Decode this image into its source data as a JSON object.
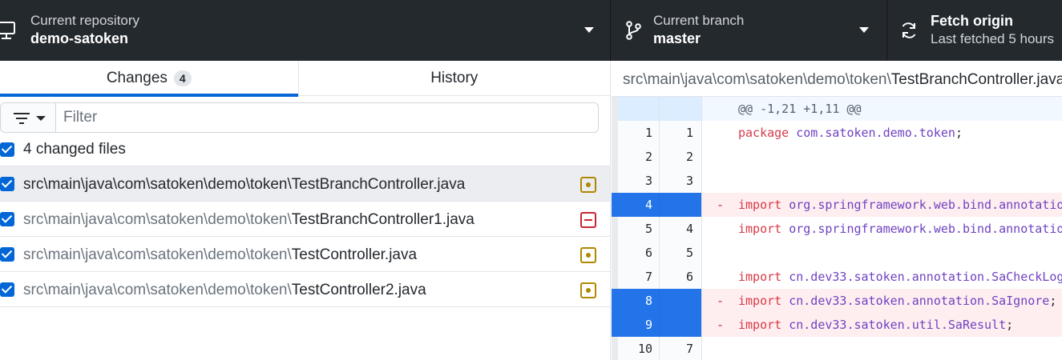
{
  "toolbar": {
    "repository": {
      "label": "Current repository",
      "value": "demo-satoken",
      "icon": "computer-icon"
    },
    "branch": {
      "label": "Current branch",
      "value": "master",
      "icon": "branch-icon"
    },
    "fetch": {
      "label": "Fetch origin",
      "sub": "Last fetched 5 hours",
      "icon": "sync-icon"
    }
  },
  "tabs": {
    "changes_label": "Changes",
    "changes_count": "4",
    "history_label": "History"
  },
  "filter": {
    "placeholder": "Filter",
    "value": ""
  },
  "changes": {
    "select_all_label": "4 changed files",
    "files": [
      {
        "dir": "src\\main\\java\\com\\satoken\\demo\\token\\",
        "name": "TestBranchController.java",
        "status": "modified",
        "checked": true,
        "selected": true
      },
      {
        "dir": "src\\main\\java\\com\\satoken\\demo\\token\\",
        "name": "TestBranchController1.java",
        "status": "deleted",
        "checked": true,
        "selected": false
      },
      {
        "dir": "src\\main\\java\\com\\satoken\\demo\\token\\",
        "name": "TestController.java",
        "status": "modified",
        "checked": true,
        "selected": false
      },
      {
        "dir": "src\\main\\java\\com\\satoken\\demo\\token\\",
        "name": "TestController2.java",
        "status": "modified",
        "checked": true,
        "selected": false
      }
    ]
  },
  "diff": {
    "path_dir": "src\\main\\java\\com\\satoken\\demo\\token\\",
    "path_file": "TestBranchController.java",
    "hunk": "@@ -1,21 +1,11 @@",
    "lines": [
      {
        "type": "context",
        "old": "1",
        "new": "1",
        "kw": "package",
        "pkg": "com.satoken.demo.token",
        "tail": ";"
      },
      {
        "type": "context",
        "old": "2",
        "new": "2",
        "kw": "",
        "pkg": "",
        "tail": ""
      },
      {
        "type": "context",
        "old": "3",
        "new": "3",
        "kw": "",
        "pkg": "",
        "tail": ""
      },
      {
        "type": "deleted",
        "old": "4",
        "new": "",
        "kw": "import",
        "pkg": "org.springframework.web.bind.annotatio",
        "tail": ""
      },
      {
        "type": "context",
        "old": "5",
        "new": "4",
        "kw": "import",
        "pkg": "org.springframework.web.bind.annotatio",
        "tail": ""
      },
      {
        "type": "context",
        "old": "6",
        "new": "5",
        "kw": "",
        "pkg": "",
        "tail": ""
      },
      {
        "type": "context",
        "old": "7",
        "new": "6",
        "kw": "import",
        "pkg": "cn.dev33.satoken.annotation.SaCheckLog",
        "tail": ""
      },
      {
        "type": "deleted",
        "old": "8",
        "new": "",
        "kw": "import",
        "pkg": "cn.dev33.satoken.annotation.SaIgnore",
        "tail": ";"
      },
      {
        "type": "deleted",
        "old": "9",
        "new": "",
        "kw": "import",
        "pkg": "cn.dev33.satoken.util.SaResult",
        "tail": ";"
      },
      {
        "type": "context",
        "old": "10",
        "new": "7",
        "kw": "",
        "pkg": "",
        "tail": ""
      }
    ]
  }
}
